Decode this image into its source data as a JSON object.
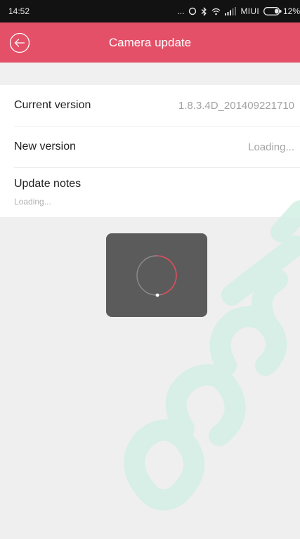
{
  "status_bar": {
    "time": "14:52",
    "dots": "...",
    "carrier": "MIUI",
    "battery": "12%"
  },
  "app_bar": {
    "title": "Camera update",
    "color": "#e45068"
  },
  "rows": {
    "current_version": {
      "label": "Current version",
      "value": "1.8.3.4D_201409221710"
    },
    "new_version": {
      "label": "New version",
      "value": "Loading..."
    },
    "update_notes": {
      "label": "Update notes",
      "value": "Loading..."
    }
  },
  "icons": {
    "back": "back-arrow-icon",
    "spinner": "loading-spinner-icon",
    "watermark": "watermark-logo"
  }
}
